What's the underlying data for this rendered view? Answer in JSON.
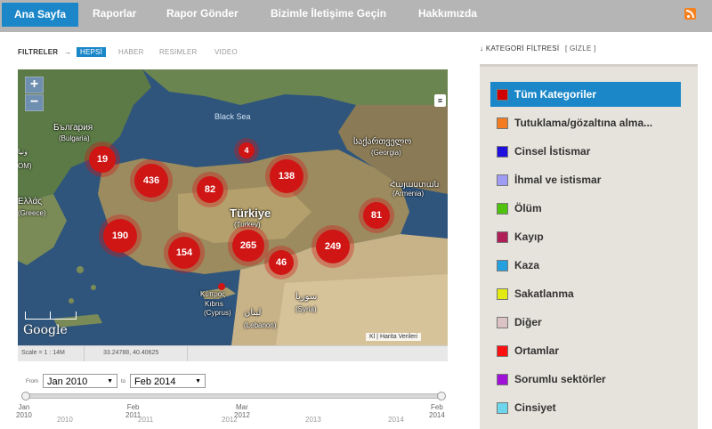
{
  "nav": {
    "items": [
      "Ana Sayfa",
      "Raporlar",
      "Rapor Gönder",
      "Bizimle İletişime Geçin",
      "Hakkımızda"
    ],
    "active": "Ana Sayfa",
    "rss_icon": "rss-icon"
  },
  "filters": {
    "label": "FILTRELER",
    "arrow": "→",
    "options": [
      "HEPSİ",
      "HABER",
      "RESIMLER",
      "VIDEO"
    ],
    "active": "HEPSİ"
  },
  "map": {
    "zoom_in": "+",
    "zoom_out": "−",
    "layers_icon": "layers-icon",
    "water_label": "Black Sea",
    "labels": [
      {
        "text": "България",
        "sub": "(Bulgaria)"
      },
      {
        "text": "Türkiye",
        "sub": "(Turkey)"
      },
      {
        "text": "საქართველო",
        "sub": "(Georgia)"
      },
      {
        "text": "Հայաստան",
        "sub": "(Armenia)"
      },
      {
        "text": "Ελλάς",
        "sub": "(Greece)"
      },
      {
        "text": "Κύπρος",
        "sub": "Kıbrıs"
      },
      {
        "text": "(Cyprus)",
        "sub": ""
      },
      {
        "text": "سوريا",
        "sub": "(Syria)"
      },
      {
        "text": "لبنان",
        "sub": "(Lebanon)"
      },
      {
        "text": "ونيا",
        "sub": "OM)"
      }
    ],
    "clusters": [
      "19",
      "436",
      "4",
      "82",
      "138",
      "81",
      "190",
      "154",
      "265",
      "249",
      "46"
    ],
    "google": "Google",
    "map_data": "Harita Verileri",
    "kl": "Kl"
  },
  "status": {
    "scale": "Scale = 1 : 14M",
    "coords": "33.24788, 40.40625"
  },
  "dates": {
    "from_label": "From",
    "from_value": "Jan 2010",
    "to_label": "to",
    "to_value": "Feb 2014",
    "ticks": [
      {
        "top": "Jan",
        "bottom": "2010"
      },
      {
        "top": "Feb",
        "bottom": "2011"
      },
      {
        "top": "Mar",
        "bottom": "2012"
      },
      {
        "top": "Feb",
        "bottom": "2014"
      }
    ],
    "years": [
      "2010",
      "2011",
      "2012",
      "2013",
      "2014"
    ],
    "caret": "▼"
  },
  "categories": {
    "header": "KATEGORİ FİLTRESİ",
    "toggle": "[ GİZLE ]",
    "header_arrow": "↓",
    "items": [
      {
        "label": "Tüm Kategoriler",
        "color": "#d00000"
      },
      {
        "label": "Tutuklama/gözaltına alma...",
        "color": "#f47b20"
      },
      {
        "label": "Cinsel İstismar",
        "color": "#1f0fdf"
      },
      {
        "label": "İhmal ve istismar",
        "color": "#9f9cf5"
      },
      {
        "label": "Ölüm",
        "color": "#4fc20e"
      },
      {
        "label": "Kayıp",
        "color": "#b01e58"
      },
      {
        "label": "Kaza",
        "color": "#25a0de"
      },
      {
        "label": "Sakatlanma",
        "color": "#e3ea12"
      },
      {
        "label": "Diğer",
        "color": "#dcc3c3"
      },
      {
        "label": "Ortamlar",
        "color": "#ff1010"
      },
      {
        "label": "Sorumlu sektörler",
        "color": "#a010d8"
      },
      {
        "label": "Cinsiyet",
        "color": "#6ed6ea"
      }
    ]
  }
}
